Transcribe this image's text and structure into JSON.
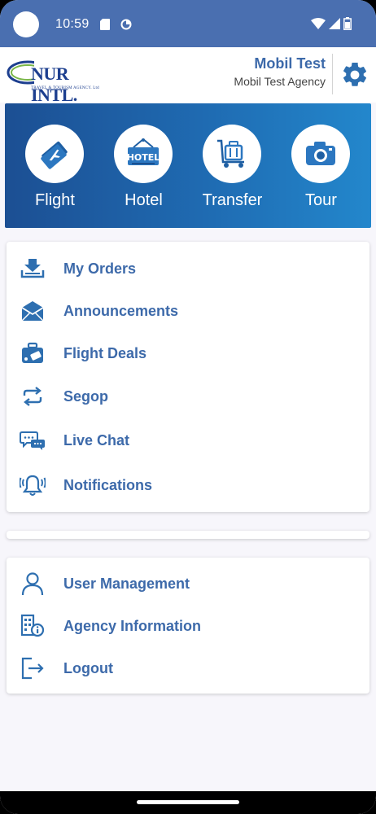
{
  "status_bar": {
    "time": "10:59"
  },
  "header": {
    "logo_text": "NUR INTL.",
    "logo_subtitle": "TRAVEL & TOURISM AGENCY. Ltd",
    "user_name": "Mobil Test",
    "agency_name": "Mobil Test Agency"
  },
  "services": [
    {
      "label": "Flight",
      "icon": "flight-ticket-icon"
    },
    {
      "label": "Hotel",
      "icon": "hotel-sign-icon"
    },
    {
      "label": "Transfer",
      "icon": "luggage-cart-icon"
    },
    {
      "label": "Tour",
      "icon": "camera-icon"
    }
  ],
  "menu_main": [
    {
      "label": "My Orders",
      "icon": "download-tray-icon"
    },
    {
      "label": "Announcements",
      "icon": "envelope-icon"
    },
    {
      "label": "Flight Deals",
      "icon": "suitcase-icon"
    },
    {
      "label": "Segop",
      "icon": "repeat-icon"
    },
    {
      "label": "Live Chat",
      "icon": "chat-bubbles-icon"
    },
    {
      "label": "Notifications",
      "icon": "bell-icon"
    }
  ],
  "menu_account": [
    {
      "label": "User Management",
      "icon": "user-icon"
    },
    {
      "label": "Agency Information",
      "icon": "building-info-icon"
    },
    {
      "label": "Logout",
      "icon": "logout-icon"
    }
  ],
  "colors": {
    "status_bar": "#4a6fb0",
    "accent": "#3d6aaa",
    "banner_start": "#1c4f93",
    "banner_end": "#2387cc"
  }
}
